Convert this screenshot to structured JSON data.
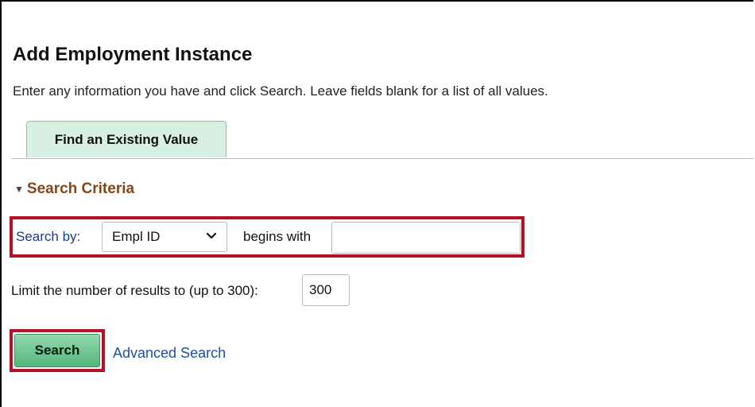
{
  "page": {
    "title": "Add Employment Instance",
    "instructions": "Enter any information you have and click Search. Leave fields blank for a list of all values."
  },
  "tabs": [
    {
      "label": "Find an Existing Value",
      "selected": true
    }
  ],
  "search_criteria": {
    "header": "Search Criteria",
    "expanded": true,
    "search_by_label": "Search by:",
    "search_by_selected": "Empl ID",
    "operator_label": "begins with",
    "value": "",
    "limit_label": "Limit the number of results to (up to 300):",
    "limit_value": "300"
  },
  "actions": {
    "search_label": "Search",
    "advanced_search_label": "Advanced Search"
  },
  "colors": {
    "highlight_border": "#b5112a",
    "tab_background": "#d7f0e2",
    "section_header": "#8b4513",
    "link": "#1f4ea8",
    "search_button": "#52b77c"
  },
  "icons": {
    "collapse": "triangle-down-icon",
    "select": "chevron-down-icon"
  }
}
